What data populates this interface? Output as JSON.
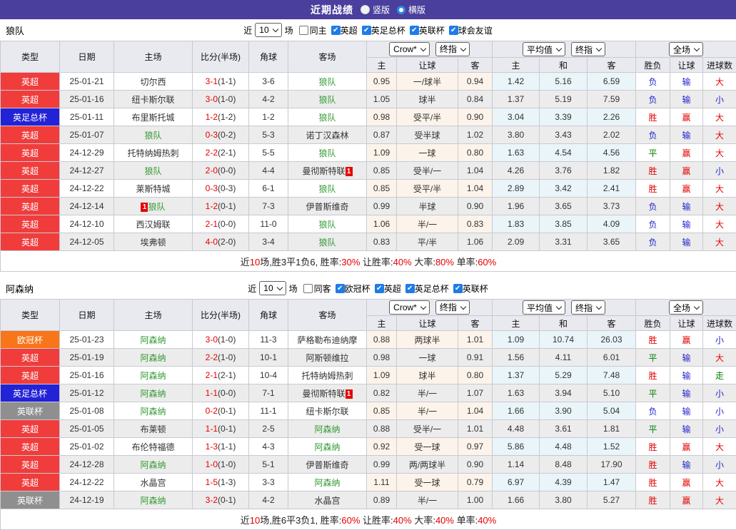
{
  "banner": {
    "title": "近期战绩",
    "options": [
      {
        "label": "竖版",
        "selected": false
      },
      {
        "label": "横版",
        "selected": true
      }
    ]
  },
  "columns": {
    "type": "类型",
    "date": "日期",
    "home": "主场",
    "score": "比分(半场)",
    "corner": "角球",
    "away": "客场",
    "sub": [
      "主",
      "让球",
      "客",
      "主",
      "和",
      "客",
      "胜负",
      "让球",
      "进球数"
    ]
  },
  "dropdowns": {
    "crow": "Crow*",
    "final": "终指",
    "avg": "平均值",
    "scope": "全场"
  },
  "colors": {
    "accent_purple": "#4a3f9d",
    "check_blue": "#1e7ce8",
    "radio_blue": "#2a8ae2",
    "team_green": "#339933",
    "score_red": "#e60000",
    "crow_bg": "#fcf4ea",
    "avg_bg": "#eaf5fa",
    "alt_row": "#ececec",
    "header_bg": "#e9e9f0"
  },
  "league_colors": {
    "英超": "#f13c3c",
    "英足总杯": "#2222d6",
    "欧冠杯": "#f8751a",
    "英联杯": "#8f8f8f"
  },
  "result_colors": {
    "r": "#e60000",
    "b": "#2323cc",
    "g": "#008000"
  },
  "sections": [
    {
      "team": "狼队",
      "filter": {
        "near": "近",
        "count": "10",
        "games": "场",
        "same": "同主",
        "same_checked": false,
        "leagues": [
          "英超",
          "英足总杯",
          "英联杯",
          "球会友谊"
        ]
      },
      "rows": [
        {
          "lg": "英超",
          "date": "25-01-21",
          "home": {
            "n": "切尔西"
          },
          "s": "3-1",
          "h": "(1-1)",
          "c": "3-6",
          "away": {
            "n": "狼队",
            "t": 1
          },
          "o": [
            "0.95",
            "一/球半",
            "0.94"
          ],
          "a": [
            "1.42",
            "5.16",
            "6.59"
          ],
          "res": [
            [
              "负",
              "b"
            ],
            [
              "输",
              "b"
            ],
            [
              "大",
              "r"
            ]
          ]
        },
        {
          "lg": "英超",
          "date": "25-01-16",
          "home": {
            "n": "纽卡斯尔联"
          },
          "s": "3-0",
          "h": "(1-0)",
          "c": "4-2",
          "away": {
            "n": "狼队",
            "t": 1
          },
          "o": [
            "1.05",
            "球半",
            "0.84"
          ],
          "a": [
            "1.37",
            "5.19",
            "7.59"
          ],
          "res": [
            [
              "负",
              "b"
            ],
            [
              "输",
              "b"
            ],
            [
              "小",
              "b"
            ]
          ]
        },
        {
          "lg": "英足总杯",
          "date": "25-01-11",
          "home": {
            "n": "布里斯托城"
          },
          "s": "1-2",
          "h": "(1-2)",
          "c": "1-2",
          "away": {
            "n": "狼队",
            "t": 1
          },
          "o": [
            "0.98",
            "受平/半",
            "0.90"
          ],
          "a": [
            "3.04",
            "3.39",
            "2.26"
          ],
          "res": [
            [
              "胜",
              "r"
            ],
            [
              "赢",
              "r"
            ],
            [
              "大",
              "r"
            ]
          ]
        },
        {
          "lg": "英超",
          "date": "25-01-07",
          "home": {
            "n": "狼队",
            "t": 1
          },
          "s": "0-3",
          "h": "(0-2)",
          "c": "5-3",
          "away": {
            "n": "诺丁汉森林"
          },
          "o": [
            "0.87",
            "受半球",
            "1.02"
          ],
          "a": [
            "3.80",
            "3.43",
            "2.02"
          ],
          "res": [
            [
              "负",
              "b"
            ],
            [
              "输",
              "b"
            ],
            [
              "大",
              "r"
            ]
          ]
        },
        {
          "lg": "英超",
          "date": "24-12-29",
          "home": {
            "n": "托特纳姆热刺"
          },
          "s": "2-2",
          "h": "(2-1)",
          "c": "5-5",
          "away": {
            "n": "狼队",
            "t": 1
          },
          "o": [
            "1.09",
            "一球",
            "0.80"
          ],
          "a": [
            "1.63",
            "4.54",
            "4.56"
          ],
          "res": [
            [
              "平",
              "g"
            ],
            [
              "赢",
              "r"
            ],
            [
              "大",
              "r"
            ]
          ]
        },
        {
          "lg": "英超",
          "date": "24-12-27",
          "home": {
            "n": "狼队",
            "t": 1
          },
          "s": "2-0",
          "h": "(0-0)",
          "c": "4-4",
          "away": {
            "n": "曼彻斯特联",
            "card": "1",
            "cardpos": "after"
          },
          "o": [
            "0.85",
            "受半/一",
            "1.04"
          ],
          "a": [
            "4.26",
            "3.76",
            "1.82"
          ],
          "res": [
            [
              "胜",
              "r"
            ],
            [
              "赢",
              "r"
            ],
            [
              "小",
              "b"
            ]
          ]
        },
        {
          "lg": "英超",
          "date": "24-12-22",
          "home": {
            "n": "莱斯特城"
          },
          "s": "0-3",
          "h": "(0-3)",
          "c": "6-1",
          "away": {
            "n": "狼队",
            "t": 1
          },
          "o": [
            "0.85",
            "受平/半",
            "1.04"
          ],
          "a": [
            "2.89",
            "3.42",
            "2.41"
          ],
          "res": [
            [
              "胜",
              "r"
            ],
            [
              "赢",
              "r"
            ],
            [
              "大",
              "r"
            ]
          ]
        },
        {
          "lg": "英超",
          "date": "24-12-14",
          "home": {
            "n": "狼队",
            "t": 1,
            "card": "1",
            "cardpos": "before"
          },
          "s": "1-2",
          "h": "(0-1)",
          "c": "7-3",
          "away": {
            "n": "伊普斯维奇"
          },
          "o": [
            "0.99",
            "半球",
            "0.90"
          ],
          "a": [
            "1.96",
            "3.65",
            "3.73"
          ],
          "res": [
            [
              "负",
              "b"
            ],
            [
              "输",
              "b"
            ],
            [
              "大",
              "r"
            ]
          ]
        },
        {
          "lg": "英超",
          "date": "24-12-10",
          "home": {
            "n": "西汉姆联"
          },
          "s": "2-1",
          "h": "(0-0)",
          "c": "11-0",
          "away": {
            "n": "狼队",
            "t": 1
          },
          "o": [
            "1.06",
            "半/一",
            "0.83"
          ],
          "a": [
            "1.83",
            "3.85",
            "4.09"
          ],
          "res": [
            [
              "负",
              "b"
            ],
            [
              "输",
              "b"
            ],
            [
              "大",
              "r"
            ]
          ]
        },
        {
          "lg": "英超",
          "date": "24-12-05",
          "home": {
            "n": "埃弗顿"
          },
          "s": "4-0",
          "h": "(2-0)",
          "c": "3-4",
          "away": {
            "n": "狼队",
            "t": 1
          },
          "o": [
            "0.83",
            "平/半",
            "1.06"
          ],
          "a": [
            "2.09",
            "3.31",
            "3.65"
          ],
          "res": [
            [
              "负",
              "b"
            ],
            [
              "输",
              "b"
            ],
            [
              "大",
              "r"
            ]
          ]
        }
      ],
      "summary": [
        [
          "近",
          "k"
        ],
        [
          "10",
          "r"
        ],
        [
          "场,胜3平1负6, 胜率:",
          "k"
        ],
        [
          "30%",
          "r"
        ],
        [
          " 让胜率:",
          "k"
        ],
        [
          "40%",
          "r"
        ],
        [
          " 大率:",
          "k"
        ],
        [
          "80%",
          "r"
        ],
        [
          " 单率:",
          "k"
        ],
        [
          "60%",
          "r"
        ]
      ]
    },
    {
      "team": "阿森纳",
      "filter": {
        "near": "近",
        "count": "10",
        "games": "场",
        "same": "同客",
        "same_checked": false,
        "leagues": [
          "欧冠杯",
          "英超",
          "英足总杯",
          "英联杯"
        ]
      },
      "rows": [
        {
          "lg": "欧冠杯",
          "date": "25-01-23",
          "home": {
            "n": "阿森纳",
            "t": 1
          },
          "s": "3-0",
          "h": "(1-0)",
          "c": "11-3",
          "away": {
            "n": "萨格勒布迪纳摩"
          },
          "o": [
            "0.88",
            "两球半",
            "1.01"
          ],
          "a": [
            "1.09",
            "10.74",
            "26.03"
          ],
          "res": [
            [
              "胜",
              "r"
            ],
            [
              "赢",
              "r"
            ],
            [
              "小",
              "b"
            ]
          ]
        },
        {
          "lg": "英超",
          "date": "25-01-19",
          "home": {
            "n": "阿森纳",
            "t": 1
          },
          "s": "2-2",
          "h": "(1-0)",
          "c": "10-1",
          "away": {
            "n": "阿斯顿维拉"
          },
          "o": [
            "0.98",
            "一球",
            "0.91"
          ],
          "a": [
            "1.56",
            "4.11",
            "6.01"
          ],
          "res": [
            [
              "平",
              "g"
            ],
            [
              "输",
              "b"
            ],
            [
              "大",
              "r"
            ]
          ]
        },
        {
          "lg": "英超",
          "date": "25-01-16",
          "home": {
            "n": "阿森纳",
            "t": 1
          },
          "s": "2-1",
          "h": "(2-1)",
          "c": "10-4",
          "away": {
            "n": "托特纳姆热刺"
          },
          "o": [
            "1.09",
            "球半",
            "0.80"
          ],
          "a": [
            "1.37",
            "5.29",
            "7.48"
          ],
          "res": [
            [
              "胜",
              "r"
            ],
            [
              "输",
              "b"
            ],
            [
              "走",
              "g"
            ]
          ]
        },
        {
          "lg": "英足总杯",
          "date": "25-01-12",
          "home": {
            "n": "阿森纳",
            "t": 1
          },
          "s": "1-1",
          "h": "(0-0)",
          "c": "7-1",
          "away": {
            "n": "曼彻斯特联",
            "card": "1",
            "cardpos": "after"
          },
          "o": [
            "0.82",
            "半/一",
            "1.07"
          ],
          "a": [
            "1.63",
            "3.94",
            "5.10"
          ],
          "res": [
            [
              "平",
              "g"
            ],
            [
              "输",
              "b"
            ],
            [
              "小",
              "b"
            ]
          ]
        },
        {
          "lg": "英联杯",
          "date": "25-01-08",
          "home": {
            "n": "阿森纳",
            "t": 1
          },
          "s": "0-2",
          "h": "(0-1)",
          "c": "11-1",
          "away": {
            "n": "纽卡斯尔联"
          },
          "o": [
            "0.85",
            "半/一",
            "1.04"
          ],
          "a": [
            "1.66",
            "3.90",
            "5.04"
          ],
          "res": [
            [
              "负",
              "b"
            ],
            [
              "输",
              "b"
            ],
            [
              "小",
              "b"
            ]
          ]
        },
        {
          "lg": "英超",
          "date": "25-01-05",
          "home": {
            "n": "布莱顿"
          },
          "s": "1-1",
          "h": "(0-1)",
          "c": "2-5",
          "away": {
            "n": "阿森纳",
            "t": 1
          },
          "o": [
            "0.88",
            "受半/一",
            "1.01"
          ],
          "a": [
            "4.48",
            "3.61",
            "1.81"
          ],
          "res": [
            [
              "平",
              "g"
            ],
            [
              "输",
              "b"
            ],
            [
              "小",
              "b"
            ]
          ]
        },
        {
          "lg": "英超",
          "date": "25-01-02",
          "home": {
            "n": "布伦特福德"
          },
          "s": "1-3",
          "h": "(1-1)",
          "c": "4-3",
          "away": {
            "n": "阿森纳",
            "t": 1
          },
          "o": [
            "0.92",
            "受一球",
            "0.97"
          ],
          "a": [
            "5.86",
            "4.48",
            "1.52"
          ],
          "res": [
            [
              "胜",
              "r"
            ],
            [
              "赢",
              "r"
            ],
            [
              "大",
              "r"
            ]
          ]
        },
        {
          "lg": "英超",
          "date": "24-12-28",
          "home": {
            "n": "阿森纳",
            "t": 1
          },
          "s": "1-0",
          "h": "(1-0)",
          "c": "5-1",
          "away": {
            "n": "伊普斯维奇"
          },
          "o": [
            "0.99",
            "两/两球半",
            "0.90"
          ],
          "a": [
            "1.14",
            "8.48",
            "17.90"
          ],
          "res": [
            [
              "胜",
              "r"
            ],
            [
              "输",
              "b"
            ],
            [
              "小",
              "b"
            ]
          ]
        },
        {
          "lg": "英超",
          "date": "24-12-22",
          "home": {
            "n": "水晶宫"
          },
          "s": "1-5",
          "h": "(1-3)",
          "c": "3-3",
          "away": {
            "n": "阿森纳",
            "t": 1
          },
          "o": [
            "1.11",
            "受一球",
            "0.79"
          ],
          "a": [
            "6.97",
            "4.39",
            "1.47"
          ],
          "res": [
            [
              "胜",
              "r"
            ],
            [
              "赢",
              "r"
            ],
            [
              "大",
              "r"
            ]
          ]
        },
        {
          "lg": "英联杯",
          "date": "24-12-19",
          "home": {
            "n": "阿森纳",
            "t": 1
          },
          "s": "3-2",
          "h": "(0-1)",
          "c": "4-2",
          "away": {
            "n": "水晶宫"
          },
          "o": [
            "0.89",
            "半/一",
            "1.00"
          ],
          "a": [
            "1.66",
            "3.80",
            "5.27"
          ],
          "res": [
            [
              "胜",
              "r"
            ],
            [
              "赢",
              "r"
            ],
            [
              "大",
              "r"
            ]
          ]
        }
      ],
      "summary": [
        [
          "近",
          "k"
        ],
        [
          "10",
          "r"
        ],
        [
          "场,胜6平3负1, 胜率:",
          "k"
        ],
        [
          "60%",
          "r"
        ],
        [
          " 让胜率:",
          "k"
        ],
        [
          "40%",
          "r"
        ],
        [
          " 大率:",
          "k"
        ],
        [
          "40%",
          "r"
        ],
        [
          " 单率:",
          "k"
        ],
        [
          "40%",
          "r"
        ]
      ]
    }
  ]
}
